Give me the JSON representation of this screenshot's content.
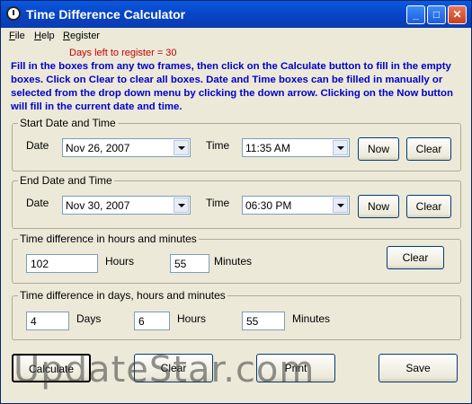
{
  "window": {
    "title": "Time Difference Calculator"
  },
  "menu": [
    "File",
    "Help",
    "Register"
  ],
  "days_left": "Days left to register = 30",
  "instructions": "Fill in the boxes from any two frames, then click on the Calculate button to fill in the empty boxes. Click on Clear to clear all boxes. Date and Time boxes can be filled in manually or selected from the drop down menu by clicking the down arrow. Clicking on the Now button will fill in the current date and time.",
  "start": {
    "legend": "Start Date and Time",
    "date_label": "Date",
    "date_value": "Nov 26, 2007",
    "time_label": "Time",
    "time_value": "11:35 AM",
    "now": "Now",
    "clear": "Clear"
  },
  "end": {
    "legend": "End Date and Time",
    "date_label": "Date",
    "date_value": "Nov 30, 2007",
    "time_label": "Time",
    "time_value": "06:30 PM",
    "now": "Now",
    "clear": "Clear"
  },
  "hm": {
    "legend": "Time difference in hours and minutes",
    "hours_value": "102",
    "hours_label": "Hours",
    "minutes_value": "55",
    "minutes_label": "Minutes",
    "clear": "Clear"
  },
  "dhm": {
    "legend": "Time difference in days, hours and minutes",
    "days_value": "4",
    "days_label": "Days",
    "hours_value": "6",
    "hours_label": "Hours",
    "minutes_value": "55",
    "minutes_label": "Minutes"
  },
  "buttons": {
    "calculate": "Calculate",
    "clear": "Clear",
    "print": "Print",
    "save": "Save"
  },
  "watermark": "UpdateStar.com"
}
